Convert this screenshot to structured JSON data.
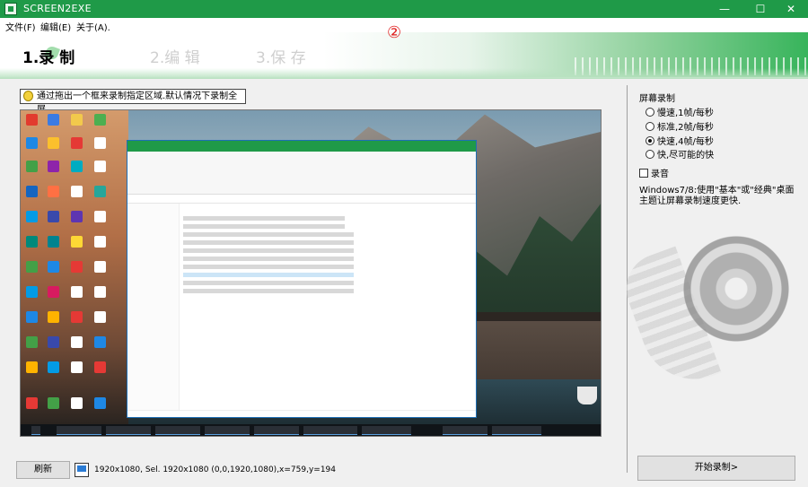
{
  "window": {
    "title": "SCREEN2EXE",
    "minimize": "—",
    "maximize": "☐",
    "close": "✕"
  },
  "menu": [
    "文件(F)",
    "编辑(E)",
    "关于(A)."
  ],
  "steps": [
    {
      "label": "1.录  制",
      "active": true
    },
    {
      "label": "2.编  辑",
      "active": false
    },
    {
      "label": "3.保  存",
      "active": false
    }
  ],
  "marker": "②",
  "hint": "通过拖出一个框来录制指定区域.默认情况下录制全屏.",
  "side": {
    "title": "屏幕录制",
    "options": [
      {
        "label": "慢速,1帧/每秒",
        "checked": false
      },
      {
        "label": "标准,2帧/每秒",
        "checked": false
      },
      {
        "label": "快速,4帧/每秒",
        "checked": true
      },
      {
        "label": "快,尽可能的快",
        "checked": false
      }
    ],
    "audio_label": "录音",
    "tip": "Windows7/8:使用\"基本\"或\"经典\"桌面主题让屏幕录制速度更快."
  },
  "bottom": {
    "refresh_label": "刷新",
    "status": "1920x1080, Sel. 1920x1080 (0,0,1920,1080),x=759,y=194",
    "start_label": "开始录制>"
  },
  "colors": {
    "titlebar": "#1f9a48",
    "marker": "#e01e1e"
  }
}
